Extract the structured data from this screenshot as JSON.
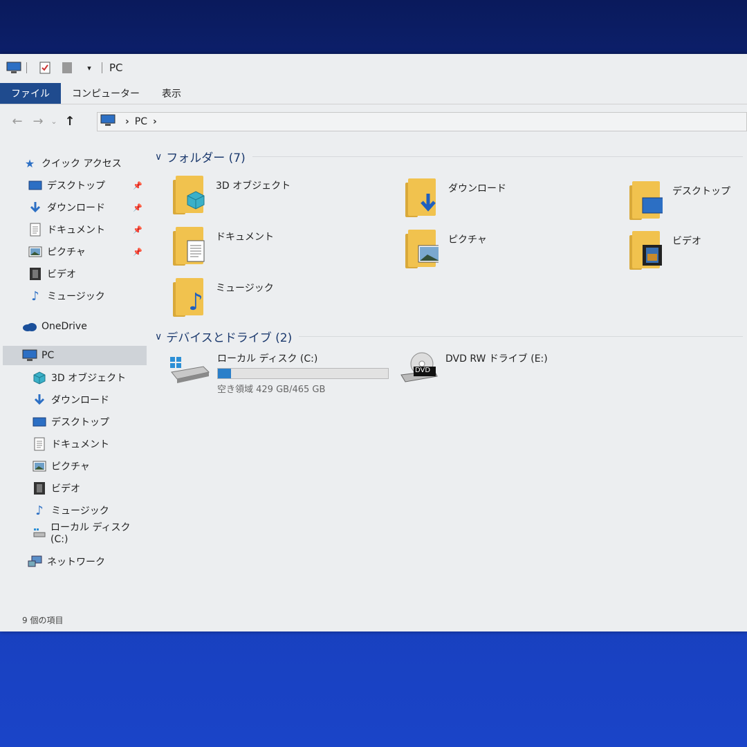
{
  "window": {
    "title": "PC",
    "ribbon_tabs": [
      "ファイル",
      "コンピューター",
      "表示"
    ],
    "address": {
      "root": "PC"
    },
    "status": "9 個の項目"
  },
  "sidebar": {
    "quick_access": "クイック アクセス",
    "quick_items": [
      {
        "label": "デスクトップ",
        "icon": "desktop-icon",
        "pinned": true
      },
      {
        "label": "ダウンロード",
        "icon": "download-icon",
        "pinned": true
      },
      {
        "label": "ドキュメント",
        "icon": "document-icon",
        "pinned": true
      },
      {
        "label": "ピクチャ",
        "icon": "picture-icon",
        "pinned": true
      },
      {
        "label": "ビデオ",
        "icon": "video-icon",
        "pinned": false
      },
      {
        "label": "ミュージック",
        "icon": "music-icon",
        "pinned": false
      }
    ],
    "onedrive": "OneDrive",
    "pc": "PC",
    "pc_items": [
      {
        "label": "3D オブジェクト",
        "icon": "3d-objects-icon"
      },
      {
        "label": "ダウンロード",
        "icon": "download-icon"
      },
      {
        "label": "デスクトップ",
        "icon": "desktop-icon"
      },
      {
        "label": "ドキュメント",
        "icon": "document-icon"
      },
      {
        "label": "ピクチャ",
        "icon": "picture-icon"
      },
      {
        "label": "ビデオ",
        "icon": "video-icon"
      },
      {
        "label": "ミュージック",
        "icon": "music-icon"
      },
      {
        "label": "ローカル ディスク (C:)",
        "icon": "local-disk-icon"
      }
    ],
    "network": "ネットワーク"
  },
  "content": {
    "folders_header": "フォルダー (7)",
    "folders": [
      {
        "label": "3D オブジェクト",
        "icon": "3d-objects-icon"
      },
      {
        "label": "ダウンロード",
        "icon": "download-icon"
      },
      {
        "label": "デスクトップ",
        "icon": "desktop-icon"
      },
      {
        "label": "ドキュメント",
        "icon": "document-icon"
      },
      {
        "label": "ピクチャ",
        "icon": "picture-icon"
      },
      {
        "label": "ビデオ",
        "icon": "video-icon"
      },
      {
        "label": "ミュージック",
        "icon": "music-icon"
      }
    ],
    "drives_header": "デバイスとドライブ (2)",
    "drives": [
      {
        "label": "ローカル ディスク (C:)",
        "free_text": "空き領域 429 GB/465 GB",
        "used_fraction": 0.077
      },
      {
        "label": "DVD RW ドライブ (E:)",
        "badge": "DVD"
      }
    ]
  },
  "colors": {
    "accent": "#1f4b8e",
    "folder": "#f1c24e",
    "bar_fill": "#2a7fc9"
  }
}
